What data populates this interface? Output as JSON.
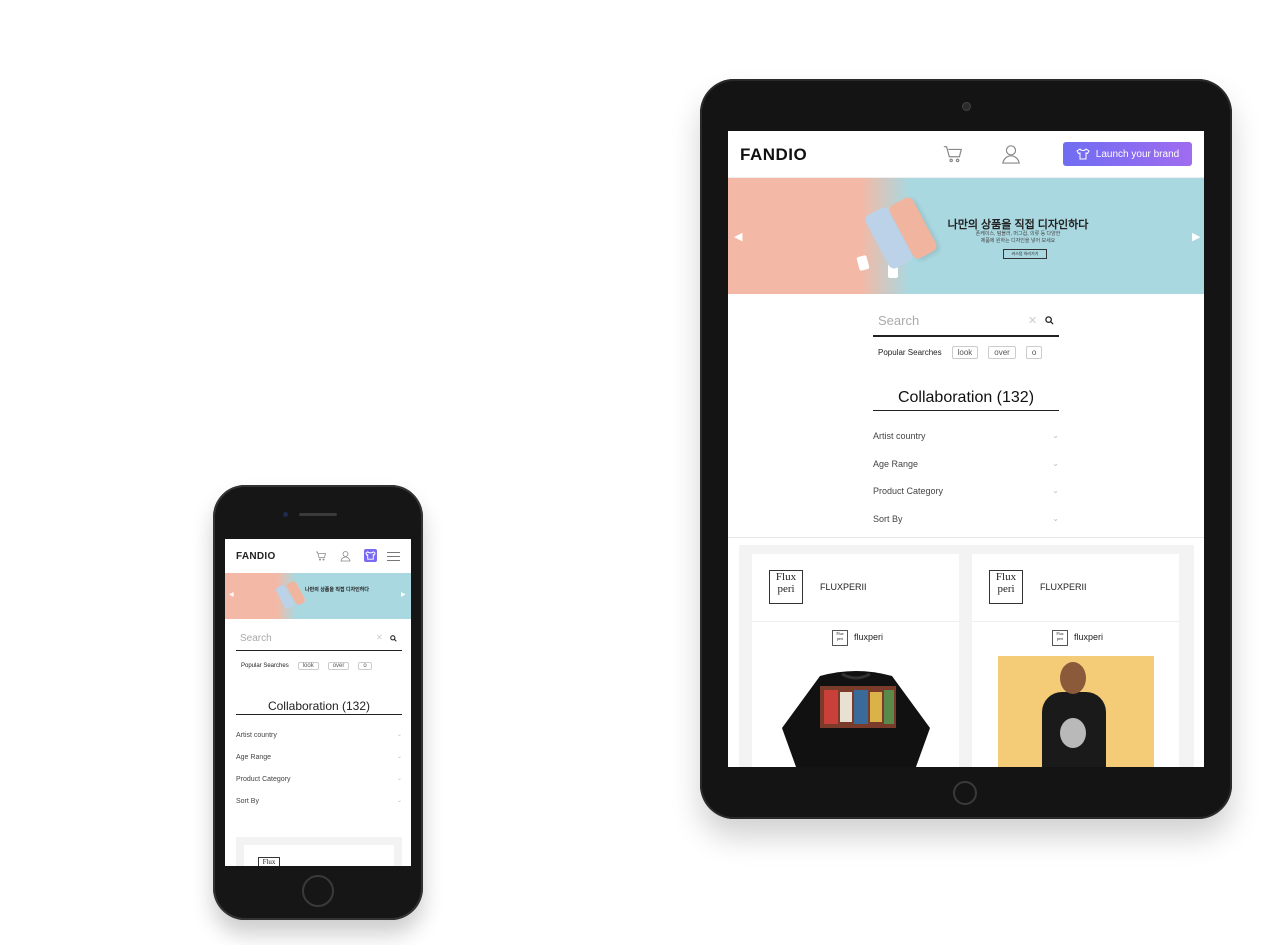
{
  "tablet": {
    "header": {
      "logo": "FANDIO",
      "launch_label": "Launch your brand"
    },
    "banner": {
      "headline": "나만의 상품을 직접 디자인하다",
      "sub_line1": "폰케이스, 텀블러, 머그컵, 의류 등 다양한",
      "sub_line2": "제품에 원하는 디자인을 넣어 보세요",
      "cta": "커스텀 하러가기"
    },
    "search": {
      "placeholder": "Search",
      "popular_label": "Popular Searches",
      "popular": [
        "look",
        "over",
        "o"
      ]
    },
    "section_title": "Collaboration (132)",
    "filters": [
      "Artist country",
      "Age Range",
      "Product Category",
      "Sort By"
    ],
    "cards": [
      {
        "brand_logo": "Flux peri",
        "brand_name": "FLUXPERII",
        "artist_logo": "Flux peri",
        "artist_name": "fluxperi"
      },
      {
        "brand_logo": "Flux peri",
        "brand_name": "FLUXPERII",
        "artist_logo": "Flux peri",
        "artist_name": "fluxperi"
      }
    ]
  },
  "phone": {
    "header": {
      "logo": "FANDIO"
    },
    "banner": {
      "headline": "나만의 상품을 직접 디자인하다"
    },
    "search": {
      "placeholder": "Search",
      "popular_label": "Popular Searches",
      "popular": [
        "look",
        "over",
        "o"
      ]
    },
    "section_title": "Collaboration (132)",
    "filters": [
      "Artist country",
      "Age Range",
      "Product Category",
      "Sort By"
    ],
    "card_logo": "Flux peri"
  },
  "colors": {
    "accent_start": "#6f6df2",
    "accent_end": "#a06cf0",
    "banner_pink": "#f3b9a6",
    "banner_blue": "#aad8e0"
  }
}
